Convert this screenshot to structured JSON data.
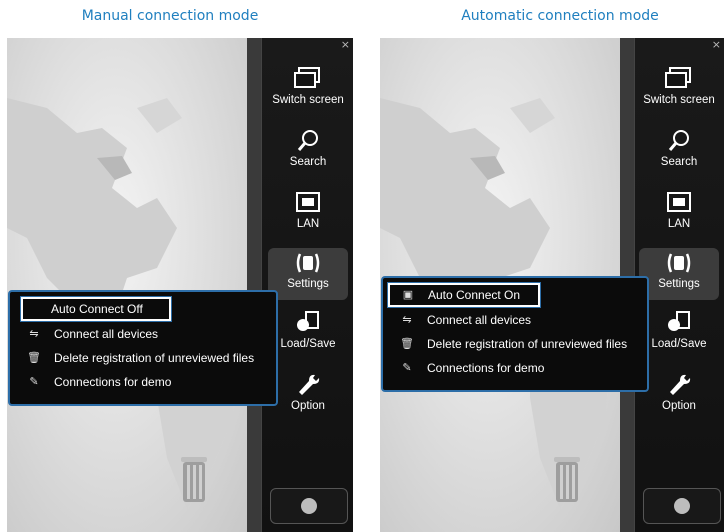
{
  "captions": {
    "left": "Manual connection mode",
    "right": "Automatic connection mode"
  },
  "toolbar": {
    "close": "×",
    "items": [
      {
        "label": "Switch screen",
        "icon": "switch-screen-icon"
      },
      {
        "label": "Search",
        "icon": "search-icon"
      },
      {
        "label": "LAN",
        "icon": "lan-icon"
      },
      {
        "label": "Settings",
        "icon": "settings-icon"
      },
      {
        "label": "Load/Save",
        "icon": "load-save-icon"
      },
      {
        "label": "Option",
        "icon": "wrench-icon"
      }
    ]
  },
  "left_menu": {
    "items": [
      {
        "label": "Auto Connect Off",
        "icon": ""
      },
      {
        "label": "Connect all devices",
        "icon": "connect-all-icon"
      },
      {
        "label": "Delete registration of unreviewed files",
        "icon": "trash-small-icon"
      },
      {
        "label": "Connections for demo",
        "icon": "plug-icon"
      }
    ]
  },
  "right_menu": {
    "items": [
      {
        "label": "Auto Connect On",
        "icon": "auto-connect-icon"
      },
      {
        "label": "Connect all devices",
        "icon": "connect-all-icon"
      },
      {
        "label": "Delete registration of unreviewed files",
        "icon": "trash-small-icon"
      },
      {
        "label": "Connections for demo",
        "icon": "plug-icon"
      }
    ]
  },
  "colors": {
    "caption": "#1f7fbf",
    "menu_border": "#2d6ea8",
    "toolbar_bg": "#141414"
  }
}
